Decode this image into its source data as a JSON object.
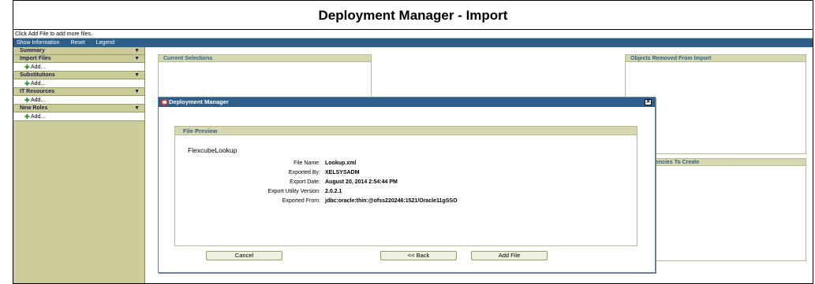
{
  "page": {
    "title": "Deployment Manager - Import",
    "hint": "Click Add File to add more files."
  },
  "menu": {
    "items": [
      "Show Information",
      "Reset",
      "Legend"
    ]
  },
  "sidebar": {
    "sections": [
      {
        "label": "Summary",
        "chevron": "▼"
      },
      {
        "label": "Import Files",
        "chevron": "▼",
        "add_label": "Add..."
      },
      {
        "label": "Substitutions",
        "chevron": "▼",
        "add_label": "Add..."
      },
      {
        "label": "IT Resources",
        "chevron": "▼",
        "add_label": "Add..."
      },
      {
        "label": "New Roles",
        "chevron": "▼",
        "add_label": "Add..."
      }
    ]
  },
  "panels": {
    "current_selections": "Current Selections",
    "objects_removed": "Objects Removed From Import",
    "dependencies": "g Dependencies To Create"
  },
  "dialog": {
    "title": "Deployment Manager",
    "close_glyph": "✕",
    "preview_title": "File Preview",
    "preview_name": "FlexcubeLookup",
    "details": [
      {
        "label": "File Name:",
        "value": "Lookup.xml"
      },
      {
        "label": "Exported By:",
        "value": "XELSYSADM"
      },
      {
        "label": "Export Date:",
        "value": "August 20, 2014 2:54:44 PM"
      },
      {
        "label": "Export Utility Version:",
        "value": "2.0.2.1"
      },
      {
        "label": "Exported From:",
        "value": "jdbc:oracle:thin:@ofss220246:1521/Oracle11gSSO"
      }
    ],
    "buttons": {
      "cancel": "Cancel",
      "back": "<< Back",
      "add_file": "Add File"
    }
  },
  "colors": {
    "accent": "#2e5f8a",
    "sidebar": "#cccc99",
    "plus": "#2a9a2a",
    "logo": "#e23b2e"
  },
  "icons": {
    "add": "plus-icon",
    "close": "close-icon",
    "logo": "oracle-logo-icon",
    "chevron": "chevron-down-icon"
  }
}
